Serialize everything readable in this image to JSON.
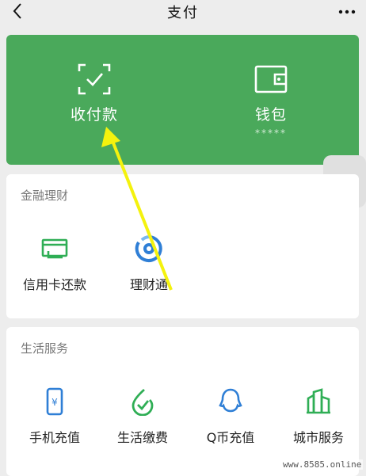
{
  "header": {
    "title": "支付"
  },
  "green_card": {
    "left": {
      "label": "收付款"
    },
    "right": {
      "label": "钱包",
      "sub": "*****"
    }
  },
  "sections": [
    {
      "title": "金融理财",
      "items": [
        {
          "label": "信用卡还款",
          "icon": "credit-card-icon"
        },
        {
          "label": "理财通",
          "icon": "wealth-icon"
        }
      ]
    },
    {
      "title": "生活服务",
      "items": [
        {
          "label": "手机充值",
          "icon": "phone-icon"
        },
        {
          "label": "生活缴费",
          "icon": "utility-icon"
        },
        {
          "label": "Q币充值",
          "icon": "qq-icon"
        },
        {
          "label": "城市服务",
          "icon": "city-icon"
        }
      ]
    }
  ],
  "watermark": "www.8585.online",
  "colors": {
    "brand_green": "#4aa95b",
    "icon_green": "#2fae55",
    "icon_blue": "#2f7fd6",
    "arrow_yellow": "#f4f20e"
  }
}
